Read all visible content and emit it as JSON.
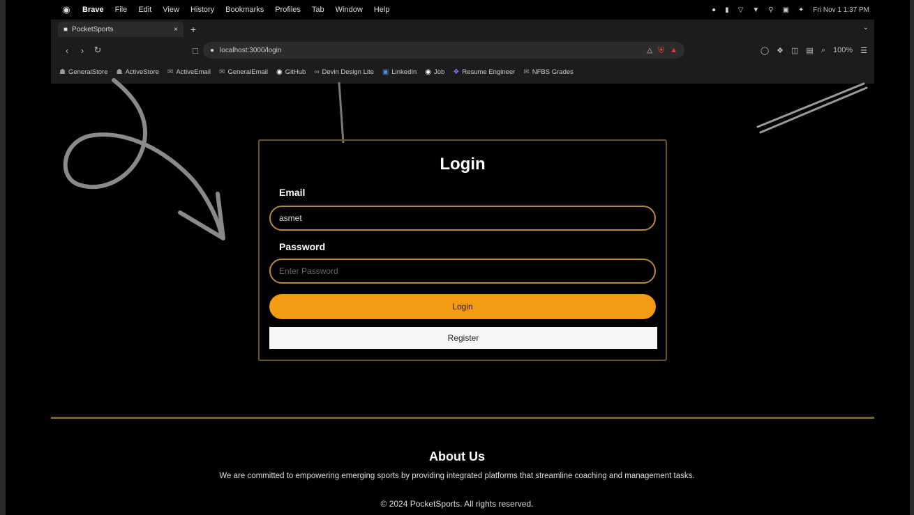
{
  "menubar": {
    "apple": "",
    "items": [
      "Brave",
      "File",
      "Edit",
      "View",
      "History",
      "Bookmarks",
      "Profiles",
      "Tab",
      "Window",
      "Help"
    ],
    "datetime": "Fri Nov 1 1:37 PM"
  },
  "browser": {
    "tab_title": "PocketSports",
    "tab_close": "×",
    "new_tab": "+",
    "tab_menu": "⌄",
    "address": "localhost:3000/login",
    "zoom": "100%",
    "bookmarks": [
      {
        "label": "GeneralStore",
        "icon": "store"
      },
      {
        "label": "ActiveStore",
        "icon": "store"
      },
      {
        "label": "ActiveEmail",
        "icon": "mail"
      },
      {
        "label": "GeneralEmail",
        "icon": "mail"
      },
      {
        "label": "GitHub",
        "icon": "github"
      },
      {
        "label": "Devin Design Lite",
        "icon": "link"
      },
      {
        "label": "LinkedIn",
        "icon": "linkedin"
      },
      {
        "label": "Job",
        "icon": "github"
      },
      {
        "label": "Resume Engineer",
        "icon": "perplexity"
      },
      {
        "label": "NFBS Grades",
        "icon": "mail"
      }
    ]
  },
  "login": {
    "title": "Login",
    "email_label": "Email",
    "email_value": "asmet",
    "password_label": "Password",
    "password_placeholder": "Enter Password",
    "login_button": "Login",
    "register_button": "Register"
  },
  "footer": {
    "about_title": "About Us",
    "about_text": "We are committed to empowering emerging sports by providing integrated platforms that streamline coaching and management tasks.",
    "copyright": "© 2024 PocketSports. All rights reserved."
  },
  "colors": {
    "accent": "#f39c12",
    "border": "#b58a3a",
    "background": "#000000"
  }
}
